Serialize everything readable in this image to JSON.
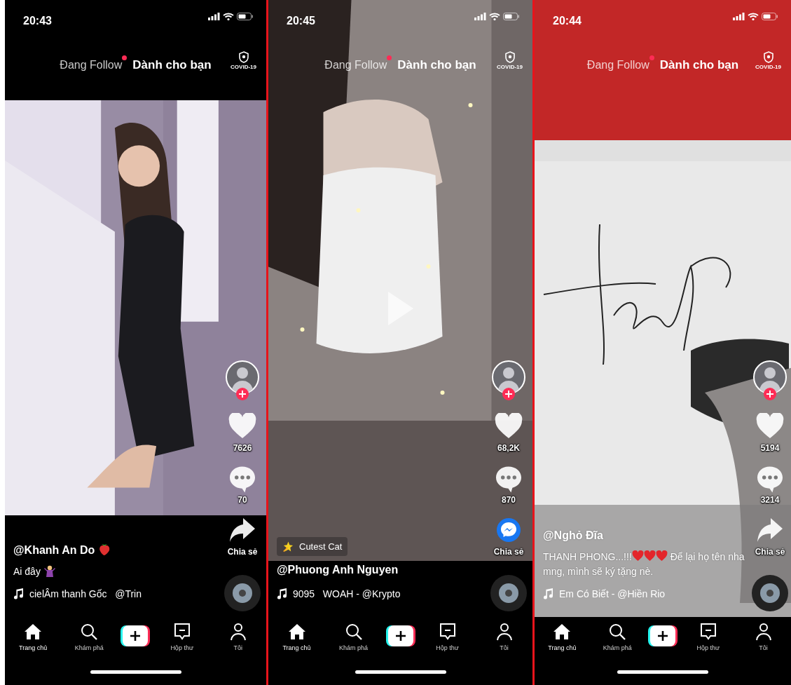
{
  "phones": [
    {
      "status_bar": {
        "time": "20:43"
      },
      "header": {
        "tabs": [
          {
            "label": "Đang Follow",
            "selected": false,
            "dot": true
          },
          {
            "label": "Dành cho bạn",
            "selected": true
          }
        ],
        "badge_label": "COVID-19"
      },
      "video": {
        "kind": "picture",
        "letterboxed": true,
        "paused": false
      },
      "sidebar": {
        "likes": "7626",
        "comments": "70",
        "share": {
          "kind": "arrow",
          "label": "Chia sẻ"
        }
      },
      "info": {
        "username": [
          {
            "kind": "text",
            "text": "@Khanh An Do "
          },
          {
            "kind": "strawberry"
          }
        ],
        "caption": [
          {
            "kind": "text",
            "text": "Ai đây "
          },
          {
            "kind": "shrug"
          }
        ],
        "music": "cielÂm thanh Gốc   @Trin"
      },
      "nav": [
        {
          "kind": "home",
          "label": "Trang chủ",
          "selected": true
        },
        {
          "kind": "search",
          "label": "Khám phá",
          "selected": false
        },
        {
          "kind": "create",
          "selected": false
        },
        {
          "kind": "inbox",
          "label": "Hộp thư",
          "selected": false
        },
        {
          "kind": "profile",
          "label": "Tôi",
          "selected": false
        }
      ]
    },
    {
      "status_bar": {
        "time": "20:45"
      },
      "header": {
        "tabs": [
          {
            "label": "Đang Follow",
            "selected": false,
            "dot": true
          },
          {
            "label": "Dành cho bạn",
            "selected": true
          }
        ],
        "badge_label": "COVID-19"
      },
      "video": {
        "kind": "picture",
        "letterboxed": false,
        "paused": true
      },
      "sidebar": {
        "likes": "68,2K",
        "comments": "870",
        "share": {
          "kind": "messenger",
          "label": "Chia sẻ"
        }
      },
      "info": {
        "effect": "Cutest Cat",
        "username": [
          {
            "kind": "text",
            "text": "@Phuong Anh Nguyen"
          }
        ],
        "music": "9095   WOAH - @Krypto"
      },
      "nav": [
        {
          "kind": "home",
          "label": "Trang chủ",
          "selected": true
        },
        {
          "kind": "search",
          "label": "Khám phá",
          "selected": false
        },
        {
          "kind": "create",
          "selected": false
        },
        {
          "kind": "inbox",
          "label": "Hộp thư",
          "selected": false
        },
        {
          "kind": "profile",
          "label": "Tôi",
          "selected": false
        }
      ]
    },
    {
      "status_bar": {
        "time": "20:44"
      },
      "header": {
        "tabs": [
          {
            "label": "Đang Follow",
            "selected": false,
            "dot": true
          },
          {
            "label": "Dành cho bạn",
            "selected": true
          }
        ],
        "badge_label": "COVID-19"
      },
      "video": {
        "kind": "picture",
        "letterboxed": false,
        "paused": false
      },
      "sidebar": {
        "likes": "5194",
        "comments": "3214",
        "share": {
          "kind": "arrow",
          "label": "Chia sẻ"
        }
      },
      "info": {
        "username": [
          {
            "kind": "text",
            "text": "@Nghỏ Đĩa"
          }
        ],
        "caption": [
          {
            "kind": "text",
            "text": "THANH PHONG...!!!"
          },
          {
            "kind": "heart"
          },
          {
            "kind": "heart"
          },
          {
            "kind": "heart"
          },
          {
            "kind": "text",
            "text": " Để lại họ tên nha mng, mình sẽ ký tặng nè."
          }
        ],
        "music": "Em Có Biết - @Hiền Rio"
      },
      "nav": [
        {
          "kind": "home",
          "label": "Trang chủ",
          "selected": true
        },
        {
          "kind": "search",
          "label": "Khám phá",
          "selected": false
        },
        {
          "kind": "create",
          "selected": false
        },
        {
          "kind": "inbox",
          "label": "Hộp thư",
          "selected": false
        },
        {
          "kind": "profile",
          "label": "Tôi",
          "selected": false
        }
      ]
    }
  ]
}
